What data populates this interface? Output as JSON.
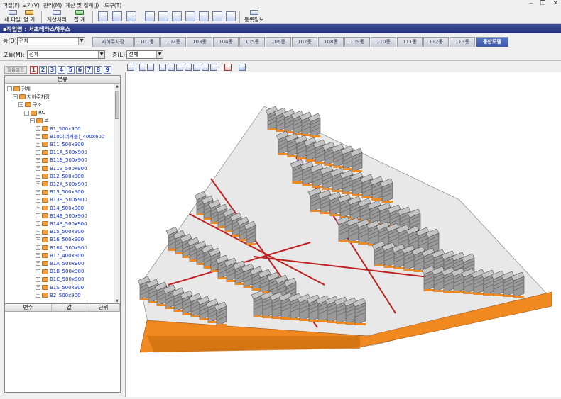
{
  "menu": [
    "파일(F)",
    "보기(V)",
    "관리(M)",
    "계산 및 집계(J)",
    "도구(T)"
  ],
  "toolbar": {
    "new_file": "새 파일",
    "open": "열 기",
    "calculate": "계산처리",
    "aggregate": "집 계",
    "register_info": "등록정보"
  },
  "title": "▪작업명 : 서초테라스하우스",
  "dong": {
    "label": "동(D):",
    "value": "전체"
  },
  "model": {
    "label": "모듈(M):",
    "value": "전체"
  },
  "floor": {
    "label": "층(L):",
    "value": "전체"
  },
  "tabs": [
    "지하주차장",
    "101동",
    "102동",
    "103동",
    "104동",
    "105동",
    "106동",
    "107동",
    "108동",
    "109동",
    "110동",
    "111동",
    "112동",
    "113동",
    "통합모델"
  ],
  "left_panel": {
    "filter_button": "필름설정",
    "numbers": [
      "1",
      "2",
      "3",
      "4",
      "5",
      "6",
      "7",
      "8",
      "9"
    ],
    "tree_header": "분류",
    "tree": [
      {
        "label": "전체",
        "level": 0,
        "color": "normal"
      },
      {
        "label": "지하주차장",
        "level": 1,
        "color": "normal"
      },
      {
        "label": "구조",
        "level": 2,
        "color": "normal"
      },
      {
        "label": "RC",
        "level": 3,
        "color": "normal"
      },
      {
        "label": "보",
        "level": 4,
        "color": "normal"
      },
      {
        "label": "B1_500x900",
        "level": 5,
        "color": "blue"
      },
      {
        "label": "B100(더커블)_400x600",
        "level": 5,
        "color": "blue"
      },
      {
        "label": "B11_500x900",
        "level": 5,
        "color": "blue"
      },
      {
        "label": "B11A_500x900",
        "level": 5,
        "color": "blue"
      },
      {
        "label": "B11B_500x900",
        "level": 5,
        "color": "blue"
      },
      {
        "label": "B11S_500x900",
        "level": 5,
        "color": "blue"
      },
      {
        "label": "B12_500x900",
        "level": 5,
        "color": "blue"
      },
      {
        "label": "B12A_500x900",
        "level": 5,
        "color": "blue"
      },
      {
        "label": "B13_500x900",
        "level": 5,
        "color": "blue"
      },
      {
        "label": "B13B_500x900",
        "level": 5,
        "color": "blue"
      },
      {
        "label": "B14_500x900",
        "level": 5,
        "color": "blue"
      },
      {
        "label": "B14B_500x900",
        "level": 5,
        "color": "blue"
      },
      {
        "label": "B14S_500x900",
        "level": 5,
        "color": "blue"
      },
      {
        "label": "B15_500x900",
        "level": 5,
        "color": "blue"
      },
      {
        "label": "B16_500x900",
        "level": 5,
        "color": "blue"
      },
      {
        "label": "B16A_500x900",
        "level": 5,
        "color": "blue"
      },
      {
        "label": "B17_400x900",
        "level": 5,
        "color": "blue"
      },
      {
        "label": "B1A_500x900",
        "level": 5,
        "color": "blue"
      },
      {
        "label": "B1B_500x900",
        "level": 5,
        "color": "blue"
      },
      {
        "label": "B1C_500x900",
        "level": 5,
        "color": "blue"
      },
      {
        "label": "B1S_500x900",
        "level": 5,
        "color": "blue"
      },
      {
        "label": "B2_500x900",
        "level": 5,
        "color": "blue"
      }
    ],
    "props_headers": [
      "변수",
      "값",
      "단위"
    ]
  }
}
